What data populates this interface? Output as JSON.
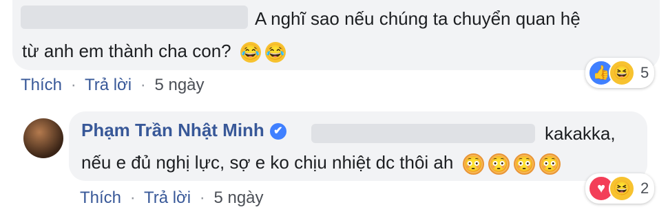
{
  "comment1": {
    "text_line1": "A nghĩ sao nếu chúng ta chuyển quan hệ",
    "text_line2": "từ anh em thành cha con?",
    "emojis": [
      "😂",
      "😂"
    ],
    "actions": {
      "like": "Thích",
      "reply": "Trả lời",
      "age": "5 ngày",
      "separator": "·"
    },
    "reactions": {
      "icons": [
        "like-icon",
        "haha-icon"
      ],
      "count": "5"
    }
  },
  "comment2": {
    "author": "Phạm Trần Nhật Minh",
    "verified_icon": "✔",
    "text_line1": "kakakka,",
    "text_line2": "nếu e đủ nghị lực, sợ e ko chịu nhiệt dc thôi ah",
    "emojis": [
      "😳",
      "😳",
      "😳",
      "😳"
    ],
    "actions": {
      "like": "Thích",
      "reply": "Trả lời",
      "age": "5 ngày",
      "separator": "·"
    },
    "reactions": {
      "icons": [
        "love-icon",
        "haha-icon"
      ],
      "count": "2"
    }
  },
  "colors": {
    "link": "#385898",
    "bubble": "#f2f3f5",
    "like": "#4080ff",
    "love": "#f33e58"
  }
}
